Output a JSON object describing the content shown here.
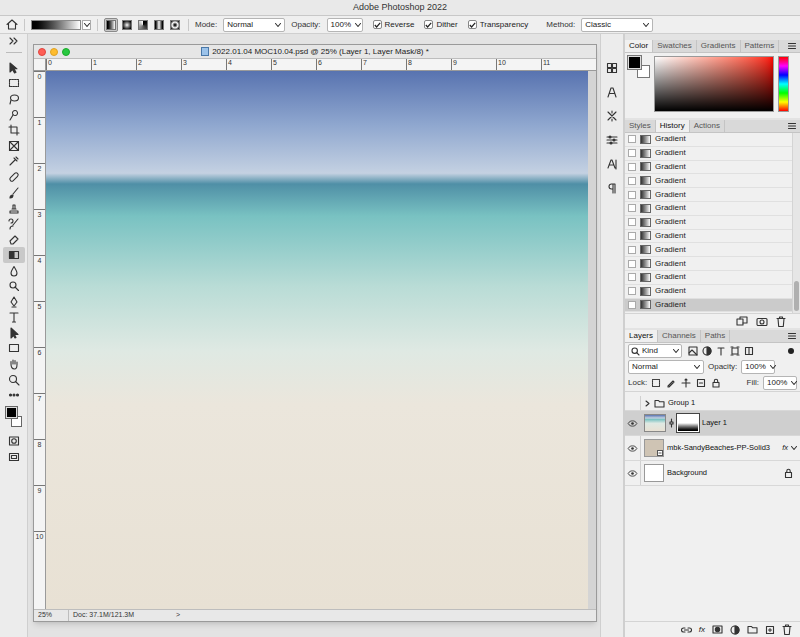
{
  "app": {
    "title": "Adobe Photoshop 2022"
  },
  "options_bar": {
    "gradient_types": [
      {
        "selected": true
      },
      {
        "selected": false
      },
      {
        "selected": false
      },
      {
        "selected": false
      },
      {
        "selected": false
      }
    ],
    "mode_label": "Mode:",
    "mode": "Normal",
    "opacity_label": "Opacity:",
    "opacity": "100%",
    "checkboxes": [
      {
        "label": "Reverse",
        "checked": true
      },
      {
        "label": "Dither",
        "checked": true
      },
      {
        "label": "Transparency",
        "checked": true
      }
    ],
    "method_label": "Method:",
    "method": "Classic"
  },
  "tools": [
    {
      "selected": false
    },
    {
      "selected": false
    },
    {
      "selected": false
    },
    {
      "selected": false
    },
    {
      "selected": false
    },
    {
      "selected": false
    },
    {
      "selected": false
    },
    {
      "selected": false
    },
    {
      "selected": false
    },
    {
      "selected": false
    },
    {
      "selected": false
    },
    {
      "selected": false
    },
    {
      "selected": true
    },
    {
      "selected": false
    },
    {
      "selected": false
    },
    {
      "selected": false
    },
    {
      "selected": false
    },
    {
      "selected": false
    },
    {
      "selected": false
    },
    {
      "selected": false
    },
    {
      "selected": false
    },
    {
      "selected": false
    }
  ],
  "document": {
    "title": "2022.01.04 MOC10.04.psd @ 25% (Layer 1, Layer Mask/8) *",
    "ruler_top": [
      "0",
      "1",
      "2",
      "3",
      "4",
      "5",
      "6",
      "7",
      "8",
      "9",
      "10",
      "11"
    ],
    "ruler_left": [
      "0",
      "1",
      "2",
      "3",
      "4",
      "5",
      "6",
      "7",
      "8",
      "9",
      "10"
    ],
    "zoom": "25%",
    "doc_info": "Doc: 37.1M/121.3M",
    "status_arrow": ">"
  },
  "color_panel": {
    "tabs": [
      {
        "label": "Color",
        "selected": true
      },
      {
        "label": "Swatches",
        "selected": false
      },
      {
        "label": "Gradients",
        "selected": false
      },
      {
        "label": "Patterns",
        "selected": false
      }
    ]
  },
  "history_panel": {
    "tabs": [
      {
        "label": "Styles",
        "selected": false
      },
      {
        "label": "History",
        "selected": true
      },
      {
        "label": "Actions",
        "selected": false
      }
    ],
    "items": [
      {
        "label": "Gradient",
        "selected": false
      },
      {
        "label": "Gradient",
        "selected": false
      },
      {
        "label": "Gradient",
        "selected": false
      },
      {
        "label": "Gradient",
        "selected": false
      },
      {
        "label": "Gradient",
        "selected": false
      },
      {
        "label": "Gradient",
        "selected": false
      },
      {
        "label": "Gradient",
        "selected": false
      },
      {
        "label": "Gradient",
        "selected": false
      },
      {
        "label": "Gradient",
        "selected": false
      },
      {
        "label": "Gradient",
        "selected": false
      },
      {
        "label": "Gradient",
        "selected": false
      },
      {
        "label": "Gradient",
        "selected": false
      },
      {
        "label": "Gradient",
        "selected": true
      }
    ]
  },
  "layers_panel": {
    "tabs": [
      {
        "label": "Layers",
        "selected": true
      },
      {
        "label": "Channels",
        "selected": false
      },
      {
        "label": "Paths",
        "selected": false
      }
    ],
    "filter": "Kind",
    "blend_mode": "Normal",
    "opacity_label": "Opacity:",
    "opacity": "100%",
    "lock_label": "Lock:",
    "fill_label": "Fill:",
    "fill": "100%",
    "layers": [
      {
        "name": "Group 1",
        "kind": "group",
        "visible": false,
        "selected": false,
        "expanded": false
      },
      {
        "name": "Layer 1",
        "kind": "masked",
        "visible": true,
        "selected": true
      },
      {
        "name": "mbk-SandyBeaches-PP-Solid3",
        "kind": "smart",
        "visible": true,
        "selected": false,
        "effects": "fx"
      },
      {
        "name": "Background",
        "kind": "background",
        "visible": true,
        "selected": false,
        "locked": true
      }
    ],
    "footer_fx": "fx"
  }
}
